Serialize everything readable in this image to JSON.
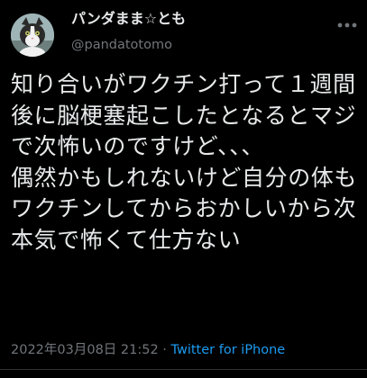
{
  "user": {
    "display_name": "パンダまま☆とも",
    "handle": "@pandatotomo"
  },
  "tweet": {
    "text": "知り合いがワクチン打って１週間後に脳梗塞起こしたとなるとマジで次怖いのですけど、、、\n偶然かもしれないけど自分の体もワクチンしてからおかしいから次本気で怖くて仕方ない",
    "timestamp": "2022年03月08日 21:52",
    "separator": " · ",
    "source": "Twitter for iPhone"
  },
  "icons": {
    "more": "more-icon",
    "avatar": "cat-avatar"
  },
  "colors": {
    "background": "#000000",
    "text": "#e7e9ea",
    "secondary": "#71767b",
    "link": "#1d9bf0"
  }
}
